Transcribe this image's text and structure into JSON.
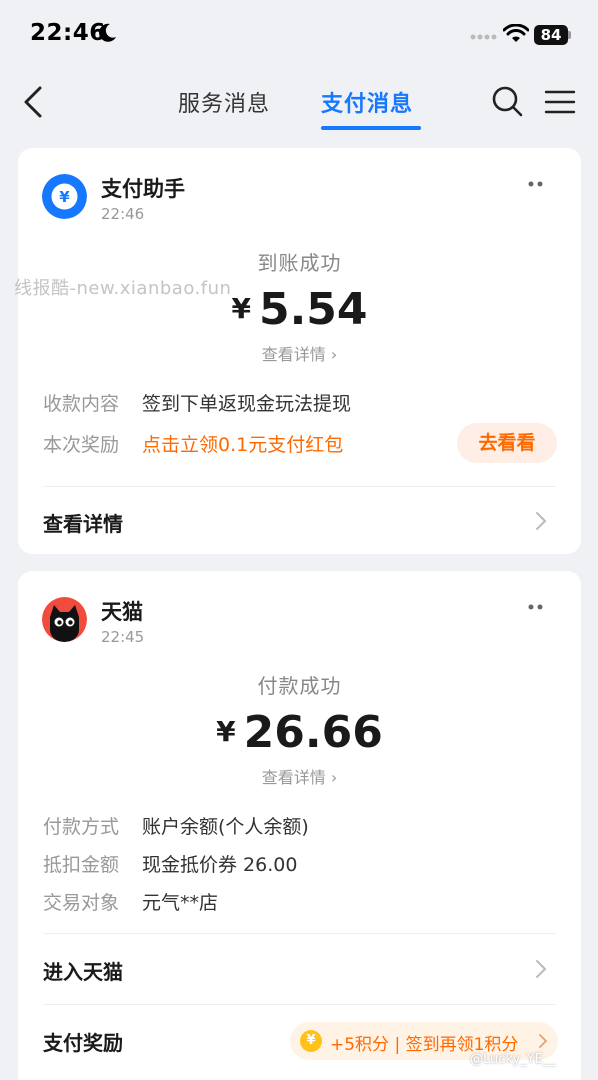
{
  "status_bar": {
    "time": "22:46",
    "battery": "84"
  },
  "nav": {
    "tabs": [
      "服务消息",
      "支付消息"
    ],
    "active_tab": "支付消息"
  },
  "colors": {
    "accent": "#1677ff",
    "orange": "#ff6a00",
    "background": "#f0f1f5"
  },
  "messages": [
    {
      "sender": "支付助手",
      "time": "22:46",
      "status": "到账成功",
      "currency": "¥",
      "amount": "5.54",
      "detail_link": "查看详情",
      "rows": [
        {
          "label": "收款内容",
          "value": "签到下单返现金玩法提现"
        },
        {
          "label": "本次奖励",
          "value": "点击立领0.1元支付红包"
        }
      ],
      "reward_button": "去看看",
      "actions": [
        "查看详情"
      ]
    },
    {
      "sender": "天猫",
      "time": "22:45",
      "status": "付款成功",
      "currency": "¥",
      "amount": "26.66",
      "detail_link": "查看详情",
      "rows": [
        {
          "label": "付款方式",
          "value": "账户余额(个人余额)"
        },
        {
          "label": "抵扣金额",
          "value": "现金抵价券 26.00"
        },
        {
          "label": "交易对象",
          "value": "元气**店"
        }
      ],
      "actions": [
        "进入天猫",
        "支付奖励"
      ],
      "reward_pill": {
        "coin": "¥",
        "text": "+5积分 | 签到再领1积分"
      }
    }
  ],
  "watermark": "线报酷-new.xianbao.fun",
  "weibo_watermark": "@Lucky_YE__"
}
